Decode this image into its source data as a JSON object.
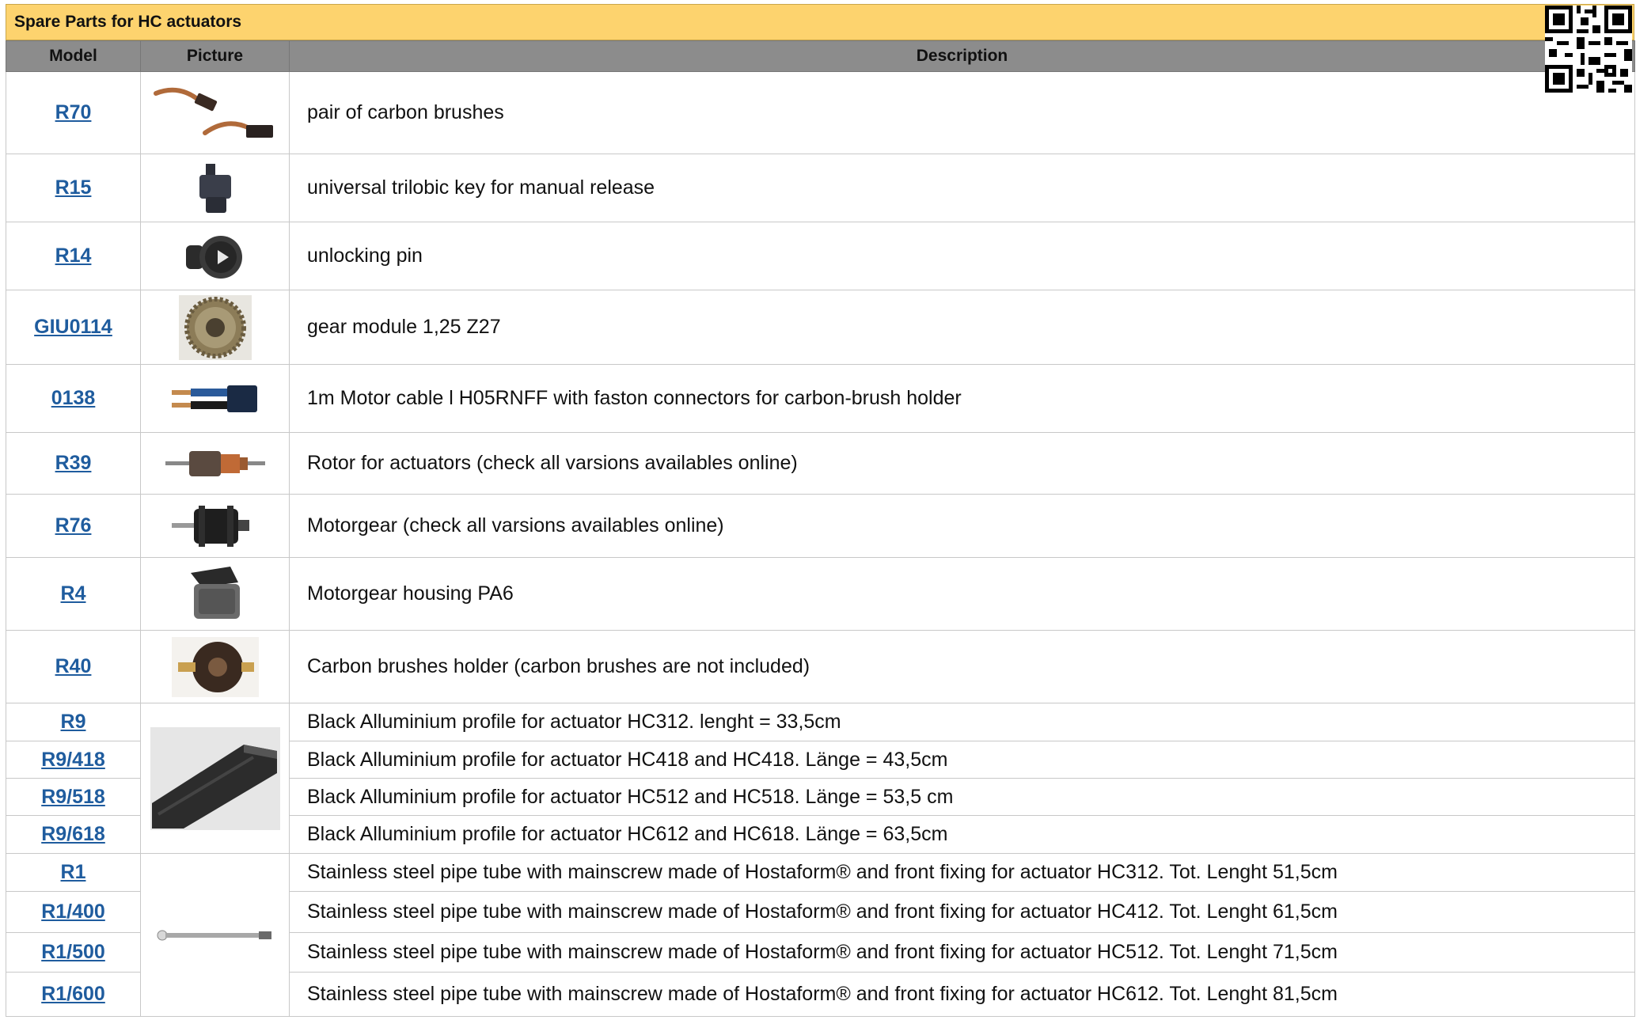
{
  "title": "Spare Parts for HC actuators",
  "headers": {
    "model": "Model",
    "picture": "Picture",
    "description": "Description"
  },
  "rows": [
    {
      "model": "R70",
      "description": "pair of carbon brushes",
      "icon": "carbon-brushes-image"
    },
    {
      "model": "R15",
      "description": "universal trilobic key for manual release",
      "icon": "trilobic-key-image"
    },
    {
      "model": "R14",
      "description": "unlocking pin",
      "icon": "unlocking-pin-image"
    },
    {
      "model": "GIU0114",
      "description": "gear module 1,25 Z27",
      "icon": "gear-image"
    },
    {
      "model": "0138",
      "description": "1m Motor cable l H05RNFF with faston connectors for carbon-brush holder",
      "icon": "motor-cable-image"
    },
    {
      "model": "R39",
      "description": "Rotor for actuators  (check all varsions availables online)",
      "icon": "rotor-image"
    },
    {
      "model": "R76",
      "description": "Motorgear (check all varsions availables online)",
      "icon": "motorgear-image"
    },
    {
      "model": "R4",
      "description": "Motorgear housing  PA6",
      "icon": "motorgear-housing-image"
    },
    {
      "model": "R40",
      "description": "Carbon brushes holder  (carbon brushes are not included)",
      "icon": "carbon-brush-holder-image"
    },
    {
      "model": "R9",
      "description": "Black Alluminium profile for actuator HC312. lenght = 33,5cm",
      "icon": "aluminium-profile-image"
    },
    {
      "model": "R9/418",
      "description": "Black Alluminium profile for actuator  HC418 and HC418. Länge = 43,5cm"
    },
    {
      "model": "R9/518",
      "description": "Black Alluminium profile for actuator HC512 and HC518. Länge = 53,5 cm"
    },
    {
      "model": "R9/618",
      "description": "Black Alluminium profile for actuator HC612  and HC618. Länge = 63,5cm"
    },
    {
      "model": "R1",
      "description": "Stainless steel pipe tube   with mainscrew made of   Hostaform®  and front fixing for actuator HC312. Tot. Lenght 51,5cm",
      "icon": "steel-pipe-tube-image"
    },
    {
      "model": "R1/400",
      "description": "Stainless steel pipe tube   with mainscrew made of   Hostaform®  and front fixing for actuator HC412.  Tot. Lenght  61,5cm"
    },
    {
      "model": "R1/500",
      "description": "Stainless steel pipe tube   with mainscrew made of   Hostaform®  and front fixing for actuator HC512.   Tot. Lenght  71,5cm"
    },
    {
      "model": "R1/600",
      "description": "Stainless steel pipe tube   with mainscrew made of   Hostaform®  and front fixing for actuator HC612.  Tot. Lenght  81,5cm"
    }
  ],
  "qr": {
    "icon": "qr-code-icon"
  },
  "colors": {
    "title_bg": "#fdd36e",
    "header_bg": "#8c8c8c",
    "link": "#1f5c9e"
  }
}
